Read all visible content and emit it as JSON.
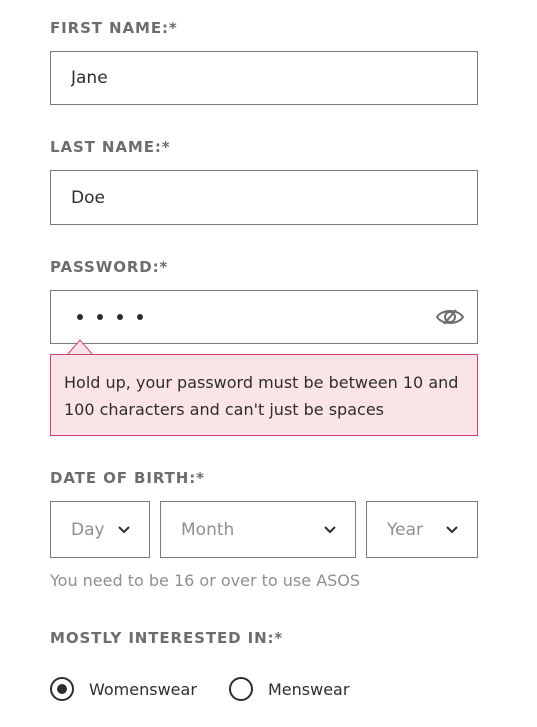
{
  "first_name": {
    "label": "FIRST NAME:*",
    "value": "Jane"
  },
  "last_name": {
    "label": "LAST NAME:*",
    "value": "Doe"
  },
  "password": {
    "label": "PASSWORD:*",
    "masked_length": 4,
    "toggle_icon": "eye-slash-icon",
    "error": "Hold up, your password must be between 10 and 100 characters and can't just be spaces",
    "error_bg": "#fbe4e8",
    "error_border": "#d0406a"
  },
  "dob": {
    "label": "DATE OF BIRTH:*",
    "day": "Day",
    "month": "Month",
    "year": "Year",
    "hint": "You need to be 16 or over to use ASOS"
  },
  "interest": {
    "label": "MOSTLY INTERESTED IN:*",
    "options": [
      {
        "label": "Womenswear",
        "selected": true
      },
      {
        "label": "Menswear",
        "selected": false
      }
    ]
  }
}
